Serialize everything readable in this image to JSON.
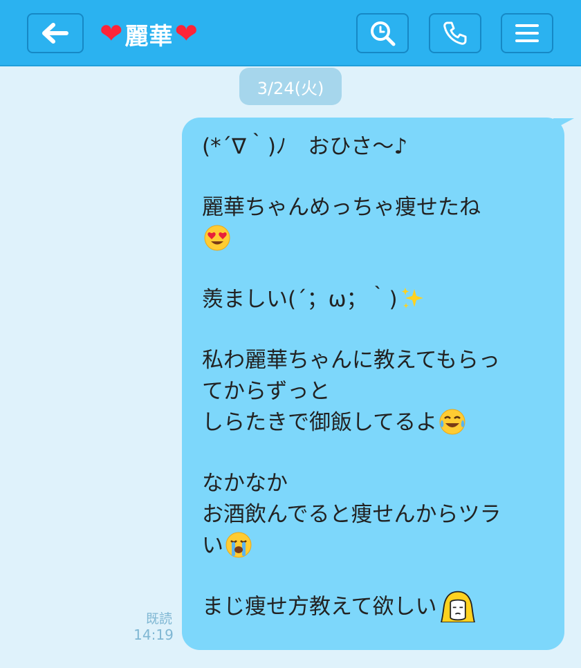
{
  "header": {
    "title": "麗華",
    "heart_left": "❤",
    "heart_right": "❤",
    "back_icon": "back-arrow-icon",
    "search_icon": "search-icon",
    "call_icon": "phone-icon",
    "menu_icon": "menu-icon",
    "bg_color": "#2bb2f0"
  },
  "date_divider": "3/24(火)",
  "message": {
    "lines": [
      "(*´∇｀)ﾉ　おひさ〜♪",
      "",
      "麗華ちゃんめっちゃ痩せたね",
      "",
      "",
      "羨ましい(´；ω；｀)",
      "",
      "私わ麗華ちゃんに教えてもらっ",
      "てからずっと",
      "しらたきで御飯してるよ",
      "",
      "なかなか",
      "お酒飲んでると痩せんからツラ",
      "い",
      "",
      "まじ痩せ方教えて欲しい"
    ],
    "emojis": {
      "love": "heart-eyes-emoji",
      "sparkles": "sparkles-emoji",
      "joy": "tears-of-joy-emoji",
      "sob": "crying-emoji",
      "sticker": "blonde-girl-emoji"
    },
    "bubble_color": "#7dd7fb"
  },
  "status": {
    "read": "既読",
    "time": "14:19"
  }
}
